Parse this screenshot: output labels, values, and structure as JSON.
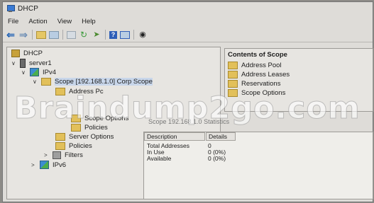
{
  "window": {
    "title": "DHCP"
  },
  "menu": [
    "File",
    "Action",
    "View",
    "Help"
  ],
  "toolbar": {
    "icons": [
      "back-icon",
      "forward-icon",
      "up-folder-icon",
      "console-tree-icon",
      "properties-icon",
      "refresh-icon",
      "export-list-icon",
      "help-icon",
      "view-icon",
      "record-icon"
    ]
  },
  "tree": {
    "root": "DHCP",
    "server": "server1",
    "ipv4": "IPv4",
    "scope": "Scope [192.168.1.0] Corp Scope",
    "address_pool": "Address Pc",
    "scope_options": "Scope Options",
    "policies_scope": "Policies",
    "server_options": "Server Options",
    "policies": "Policies",
    "filters": "Filters",
    "ipv6": "IPv6"
  },
  "contents": {
    "header": "Contents of Scope",
    "items": [
      "Address Pool",
      "Address Leases",
      "Reservations",
      "Scope Options"
    ]
  },
  "stats": {
    "title": "Scope 192.168.1.0 Statistics",
    "columns": [
      "Description",
      "Details"
    ],
    "rows": [
      {
        "description": "Total Addresses",
        "details": "0"
      },
      {
        "description": "In Use",
        "details": "0 (0%)"
      },
      {
        "description": "Available",
        "details": "0 (0%)"
      }
    ]
  },
  "watermark": "Braindump2go.com"
}
